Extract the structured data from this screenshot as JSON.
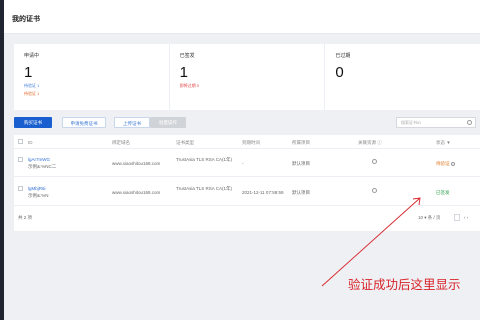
{
  "page": {
    "title": "我的证书"
  },
  "stats": [
    {
      "label": "申请中",
      "value": "1",
      "subs": [
        "待验证 1",
        "待验证 1"
      ]
    },
    {
      "label": "已签发",
      "value": "1",
      "subs": [
        "即将过期 0"
      ]
    },
    {
      "label": "已过期",
      "value": "0",
      "subs": []
    }
  ],
  "toolbar": {
    "buy_label": "购买证书",
    "apply_label": "申请免费证书",
    "upload_label": "上传证书",
    "more_label": "批量操作",
    "search_placeholder": "搜索证书ID"
  },
  "table": {
    "headers": [
      "ID",
      "绑定域名",
      "证书类型",
      "到期时间",
      "所属项目",
      "关联资源 ⓘ",
      "状态 ▼"
    ],
    "rows": [
      {
        "id": "lgAr7mWG",
        "note": "示例&:%NC二",
        "domain": "www.xiaoshitou168.com",
        "type": "TrustAsia TLS RSA CA(1年)",
        "expiry": "-",
        "project": "默认项目",
        "status": "待验证"
      },
      {
        "id": "lgMbjR6i",
        "note": "示例&:%N",
        "domain": "www.xiaoshitou168.com",
        "type": "TrustAsia TLS RSA CA(1年)",
        "expiry": "2021-12-11 07:59:59",
        "project": "默认项目",
        "status": "已签发"
      }
    ],
    "total": "共 2 项",
    "page_size": "10 ▾ 条 / 页"
  },
  "annotation": {
    "text": "验证成功后这里显示"
  },
  "colors": {
    "primary": "#1a5fd0",
    "link": "#2f6fd6",
    "green": "#2aa34a",
    "orange": "#e07a1f",
    "callout": "#d8232a"
  }
}
